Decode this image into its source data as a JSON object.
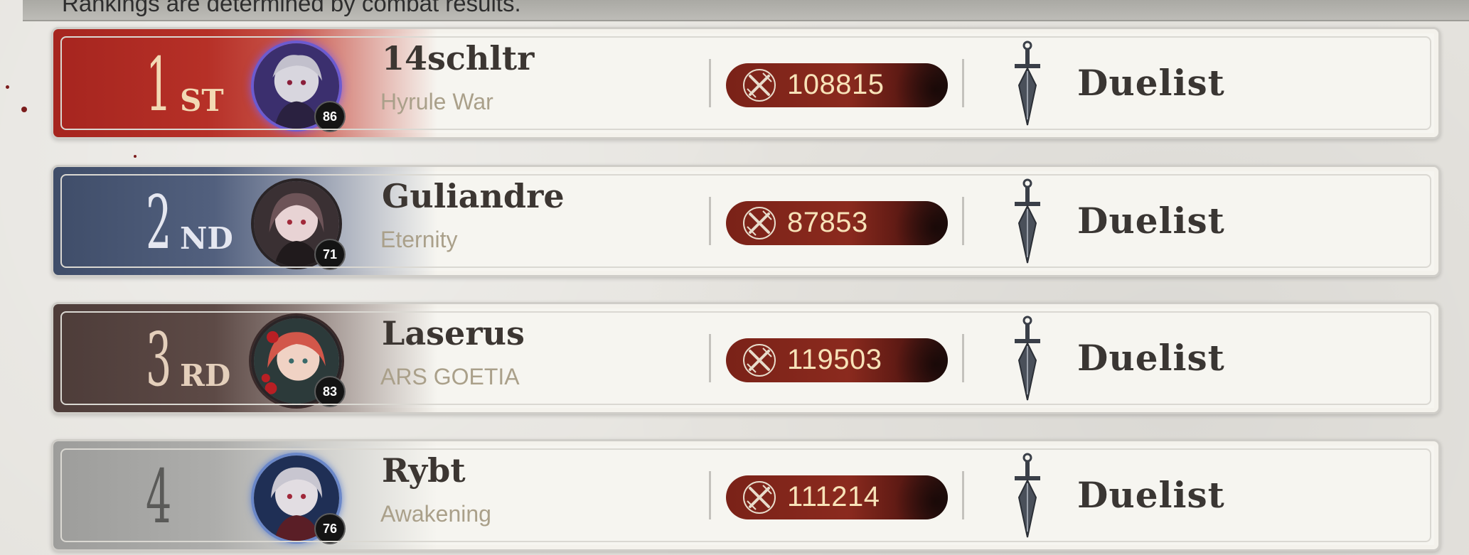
{
  "header": {
    "note": "Rankings are determined by combat results."
  },
  "colors": {
    "rank1": "#a6251f",
    "rank2": "#3f4d69",
    "rank3": "#4d3c39",
    "rank4": "#9d9d9b",
    "score_pill": "#8b2a1e",
    "score_text": "#f7e2b8"
  },
  "rankings": [
    {
      "rank": "1",
      "suffix": "ST",
      "level": "86",
      "name": "14schltr",
      "guild": "Hyrule War",
      "score": "108815",
      "title": "Duelist"
    },
    {
      "rank": "2",
      "suffix": "ND",
      "level": "71",
      "name": "Guliandre",
      "guild": "Eternity",
      "score": "87853",
      "title": "Duelist"
    },
    {
      "rank": "3",
      "suffix": "RD",
      "level": "83",
      "name": "Laserus",
      "guild": "ARS GOETIA",
      "score": "119503",
      "title": "Duelist"
    },
    {
      "rank": "4",
      "suffix": "",
      "level": "76",
      "name": "Rybt",
      "guild": "Awakening",
      "score": "111214",
      "title": "Duelist"
    }
  ],
  "icons": {
    "score": "crossed-swords-icon",
    "title": "dagger-icon"
  }
}
